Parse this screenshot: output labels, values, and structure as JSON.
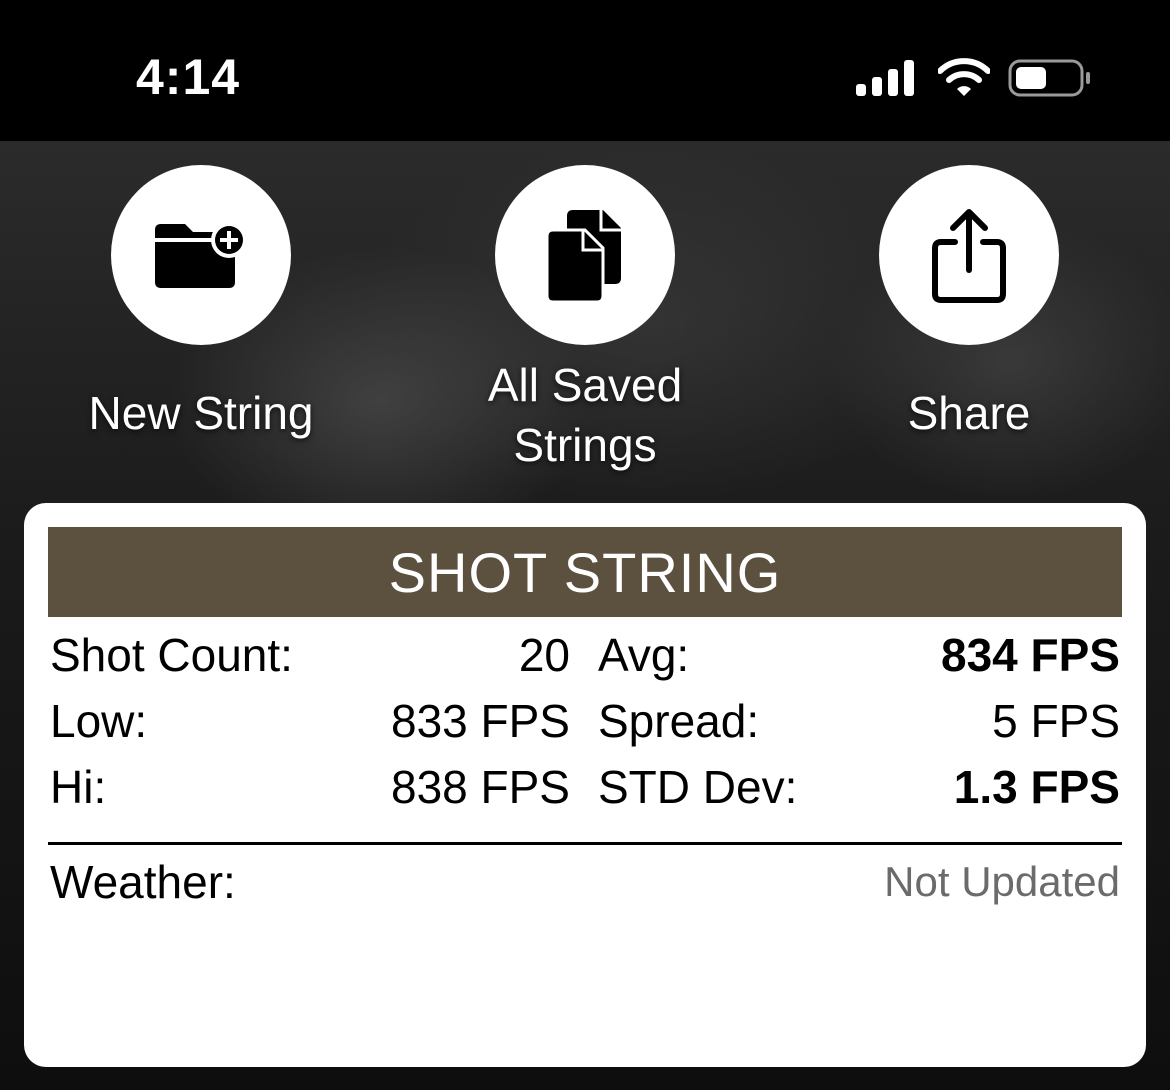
{
  "status_bar": {
    "time": "4:14",
    "icons": [
      "signal-icon",
      "wifi-icon",
      "battery-icon"
    ]
  },
  "actions": [
    {
      "label": "New String",
      "icon": "new-folder-icon"
    },
    {
      "label": "All Saved\nStrings",
      "icon": "documents-icon"
    },
    {
      "label": "Share",
      "icon": "share-icon"
    }
  ],
  "card": {
    "header": "SHOT STRING",
    "header_color": "#5c513f",
    "left_stats": [
      {
        "label": "Shot Count:",
        "value": "20"
      },
      {
        "label": "Low:",
        "value": "833 FPS"
      },
      {
        "label": "Hi:",
        "value": "838 FPS"
      }
    ],
    "right_stats": [
      {
        "label": "Avg:",
        "value": "834 FPS"
      },
      {
        "label": "Spread:",
        "value": "5 FPS"
      },
      {
        "label": "STD Dev:",
        "value": "1.3 FPS"
      }
    ],
    "weather_label": "Weather:",
    "weather_value": "Not Updated"
  }
}
